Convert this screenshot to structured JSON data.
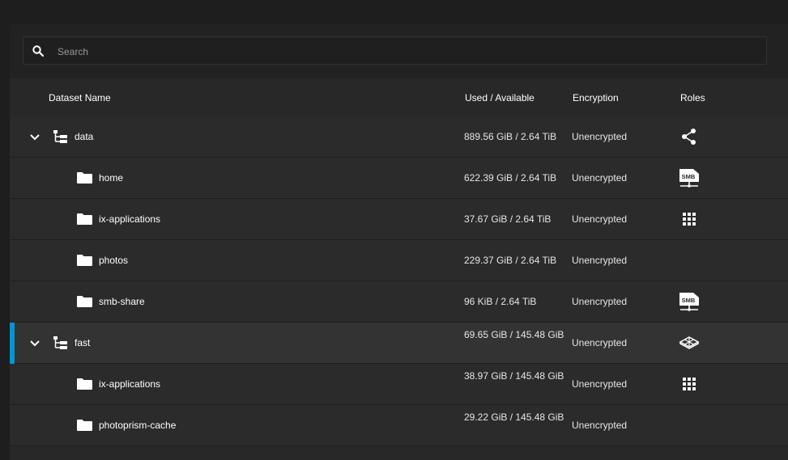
{
  "search": {
    "placeholder": "Search"
  },
  "columns": {
    "name": "Dataset Name",
    "used": "Used / Available",
    "encryption": "Encryption",
    "roles": "Roles"
  },
  "rows": [
    {
      "name": "data",
      "used": "889.56 GiB / 2.64 TiB",
      "encryption": "Unencrypted",
      "role_icon": "share-icon"
    },
    {
      "name": "home",
      "used": "622.39 GiB / 2.64 TiB",
      "encryption": "Unencrypted",
      "role_icon": "smb-share-icon"
    },
    {
      "name": "ix-applications",
      "used": "37.67 GiB / 2.64 TiB",
      "encryption": "Unencrypted",
      "role_icon": "apps-grid-icon"
    },
    {
      "name": "photos",
      "used": "229.37 GiB / 2.64 TiB",
      "encryption": "Unencrypted",
      "role_icon": ""
    },
    {
      "name": "smb-share",
      "used": "96 KiB / 2.64 TiB",
      "encryption": "Unencrypted",
      "role_icon": "smb-share-icon"
    },
    {
      "name": "fast",
      "used": "69.65 GiB / 145.48 GiB",
      "encryption": "Unencrypted",
      "role_icon": "system-dataset-icon",
      "selected": true
    },
    {
      "name": "ix-applications",
      "used": "38.97 GiB / 145.48 GiB",
      "encryption": "Unencrypted",
      "role_icon": "apps-grid-icon"
    },
    {
      "name": "photoprism-cache",
      "used": "29.22 GiB / 145.48 GiB",
      "encryption": "Unencrypted",
      "role_icon": ""
    }
  ],
  "colors": {
    "accent": "#0095d5",
    "background": "#1e1e1e",
    "row": "#2b2b2b",
    "selected_row": "#333333"
  }
}
